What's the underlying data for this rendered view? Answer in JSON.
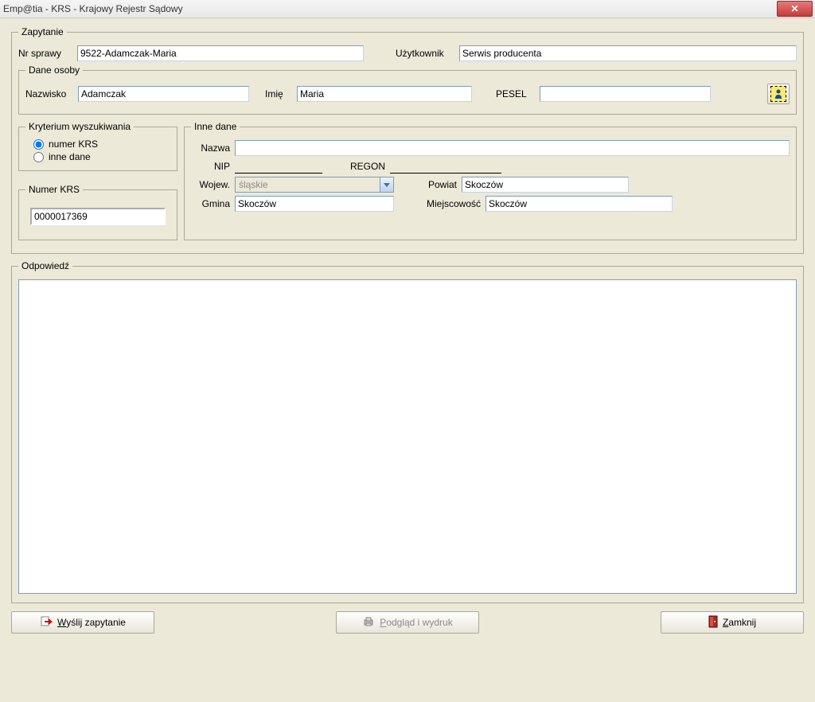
{
  "window": {
    "title": "Emp@tia - KRS - Krajowy Rejestr Sądowy"
  },
  "zapytanie": {
    "legend": "Zapytanie",
    "nr_sprawy_label": "Nr sprawy",
    "nr_sprawy_value": "9522-Adamczak-Maria",
    "uzytkownik_label": "Użytkownik",
    "uzytkownik_value": "Serwis producenta"
  },
  "dane_osoby": {
    "legend": "Dane osoby",
    "nazwisko_label": "Nazwisko",
    "nazwisko_value": "Adamczak",
    "imie_label": "Imię",
    "imie_value": "Maria",
    "pesel_label": "PESEL",
    "pesel_value": ""
  },
  "kryterium": {
    "legend": "Kryterium wyszukiwania",
    "opt1": "numer KRS",
    "opt2": "inne dane",
    "selected": "numer KRS"
  },
  "numer_krs": {
    "legend": "Numer KRS",
    "value": "0000017369"
  },
  "inne_dane": {
    "legend": "Inne dane",
    "nazwa_label": "Nazwa",
    "nazwa_value": "",
    "nip_label": "NIP",
    "nip_value": "",
    "regon_label": "REGON",
    "regon_value": "",
    "wojew_label": "Wojew.",
    "wojew_value": "śląskie",
    "powiat_label": "Powiat",
    "powiat_value": "Skoczów",
    "gmina_label": "Gmina",
    "gmina_value": "Skoczów",
    "miejsc_label": "Miejscowość",
    "miejsc_value": "Skoczów"
  },
  "odpowiedz": {
    "legend": "Odpowiedź",
    "value": ""
  },
  "buttons": {
    "wyslij": "Wyślij zapytanie",
    "podglad": "Podgląd i wydruk",
    "zamknij": "Zamknij"
  }
}
